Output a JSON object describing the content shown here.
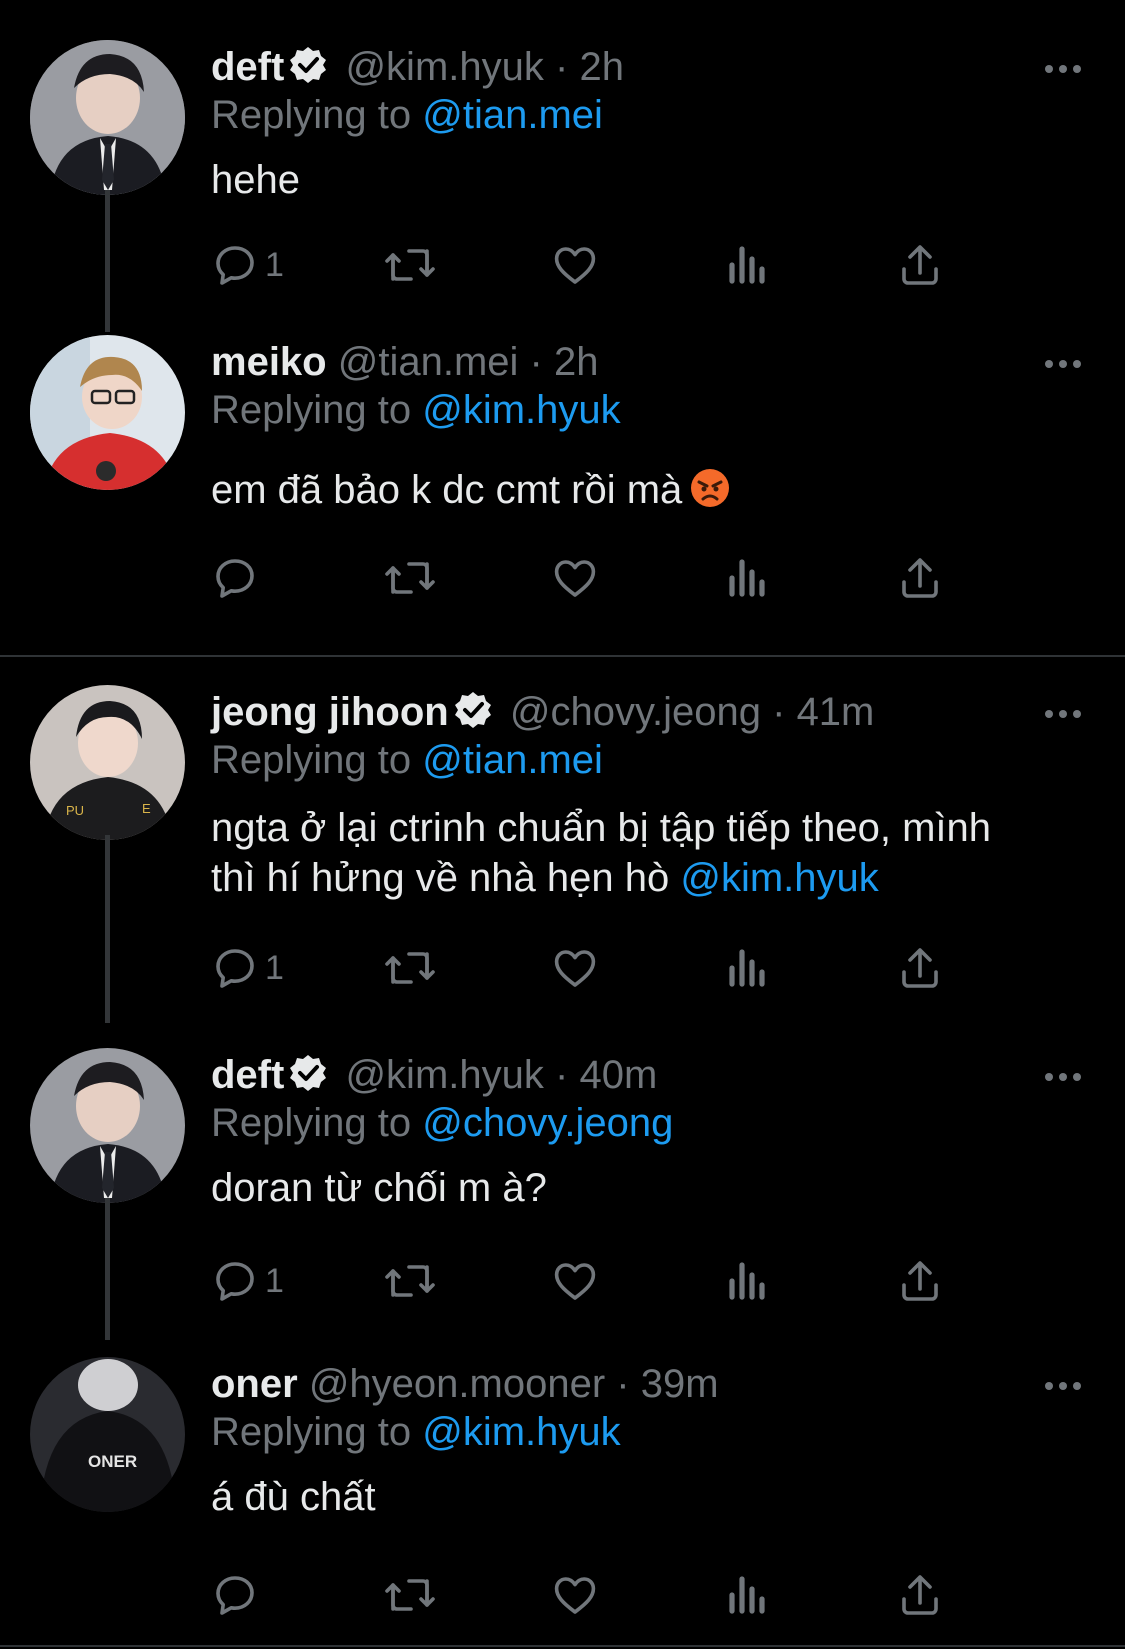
{
  "tweets": [
    {
      "name": "deft",
      "verified": true,
      "handle": "@kim.hyuk",
      "dot": "·",
      "time": "2h",
      "replying_prefix": "Replying to ",
      "replying_to": "@tian.mei",
      "text": "hehe",
      "reply_count": "1"
    },
    {
      "name": "meiko",
      "verified": false,
      "handle": "@tian.mei",
      "dot": "·",
      "time": "2h",
      "replying_prefix": "Replying to ",
      "replying_to": "@kim.hyuk",
      "text": "em đã bảo k dc cmt rồi mà",
      "emoji": "angry-face-emoji",
      "reply_count": ""
    },
    {
      "name": "jeong jihoon",
      "verified": true,
      "handle": "@chovy.jeong",
      "dot": "·",
      "time": "41m",
      "replying_prefix": "Replying to ",
      "replying_to": "@tian.mei",
      "text_line1": "ngta ở lại ctrinh chuẩn bị tập tiếp theo, mình",
      "text_line2": "thì hí hửng về nhà hẹn hò ",
      "text_mention": "@kim.hyuk",
      "reply_count": "1"
    },
    {
      "name": "deft",
      "verified": true,
      "handle": "@kim.hyuk",
      "dot": "·",
      "time": "40m",
      "replying_prefix": "Replying to ",
      "replying_to": "@chovy.jeong",
      "text": "doran từ chối m à?",
      "reply_count": "1"
    },
    {
      "name": "oner",
      "verified": false,
      "handle": "@hyeon.mooner",
      "dot": "·",
      "time": "39m",
      "replying_prefix": "Replying to ",
      "replying_to": "@kim.hyuk",
      "text": "á đù chất",
      "avatar_text": "ONER",
      "reply_count": ""
    }
  ],
  "colors": {
    "background": "#000000",
    "primary_text": "#e7e9ea",
    "secondary_text": "#71767b",
    "accent": "#1d9bf0",
    "thread_line": "#333639"
  },
  "icons": [
    "reply-icon",
    "retweet-icon",
    "like-icon",
    "views-icon",
    "share-icon",
    "verified-badge-icon",
    "more-icon"
  ]
}
